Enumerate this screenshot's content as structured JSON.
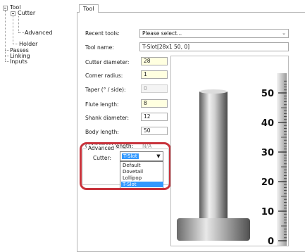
{
  "tree": {
    "tool": "Tool",
    "cutter": "Cutter",
    "advanced": "Advanced",
    "holder": "Holder",
    "passes": "Passes",
    "linking": "Linking",
    "inputs": "Inputs"
  },
  "tab": {
    "label": "Tool"
  },
  "fields": {
    "recent_tools": {
      "label": "Recent tools:",
      "value": "Please select..."
    },
    "tool_name": {
      "label": "Tool name:",
      "value": "T-Slot[28x1 50, 0]"
    },
    "cutter_diameter": {
      "label": "Cutter diameter:",
      "value": "28"
    },
    "corner_radius": {
      "label": "Corner radius:",
      "value": "1"
    },
    "taper": {
      "label": "Taper (° / side):",
      "value": "0"
    },
    "flute_length": {
      "label": "Flute length:",
      "value": "8"
    },
    "shank_diameter": {
      "label": "Shank diameter:",
      "value": "12"
    },
    "body_length": {
      "label": "Body length:",
      "value": "50"
    },
    "cylindrical_length": {
      "label": "Cylindrical length:",
      "value": "N/A"
    }
  },
  "advanced": {
    "title": "Advanced",
    "cutter_label": "Cutter:",
    "selected": "T-Slot",
    "options": [
      "Default",
      "Dovetail",
      "Lollipop",
      "T-Slot"
    ]
  },
  "preview": {
    "scale_labels": [
      "50",
      "40",
      "30",
      "20",
      "10",
      "0"
    ],
    "colors": {
      "highlight": "#c8333c",
      "selection": "#3399ff",
      "required_field": "#ffffe0"
    }
  }
}
